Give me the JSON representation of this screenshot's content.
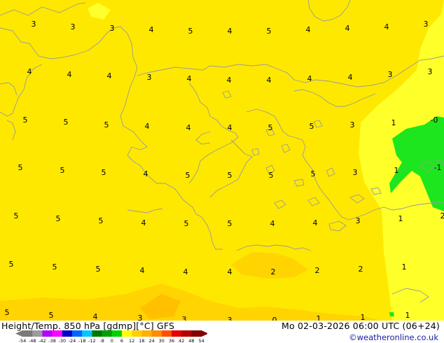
{
  "map": {
    "field_colors": {
      "land_base": "#ffe800",
      "light_yellow": "#ffff2a",
      "dark_yellow": "#ffd400",
      "orange_blob": "#ffc000",
      "green": "#1ee61e",
      "coastline": "#9a9a9a",
      "land_top": "#ffea00",
      "green_edge": "#14d214"
    },
    "grid_values": [
      "3",
      "3",
      "3",
      "4",
      "5",
      "4",
      "5",
      "4",
      "4",
      "4",
      "3",
      "4",
      "4",
      "4",
      "3",
      "4",
      "4",
      "4",
      "4",
      "4",
      "3",
      "3",
      "5",
      "5",
      "5",
      "4",
      "4",
      "4",
      "5",
      "5",
      "3",
      "1",
      "-0",
      "5",
      "5",
      "5",
      "4",
      "5",
      "5",
      "5",
      "5",
      "3",
      "1",
      "-1",
      "5",
      "5",
      "5",
      "4",
      "5",
      "5",
      "4",
      "4",
      "3",
      "1",
      "2",
      "5",
      "5",
      "5",
      "4",
      "4",
      "4",
      "2",
      "2",
      "2",
      "1",
      "5",
      "5",
      "4",
      "3",
      "3",
      "3",
      "0",
      "1",
      "1",
      "1"
    ]
  },
  "footer": {
    "title": "Height/Temp. 850 hPa [gdmp][°C] GFS",
    "valid": "Mo 02-03-2026 06:00 UTC (06+24)",
    "credit": "©weatheronline.co.uk"
  },
  "scale": {
    "ticks": [
      "-54",
      "-48",
      "-42",
      "-38",
      "-30",
      "-24",
      "-18",
      "-12",
      "-8",
      "0",
      "6",
      "12",
      "18",
      "24",
      "30",
      "36",
      "42",
      "48",
      "54"
    ],
    "colors": [
      "#7a7a7a",
      "#9c9c9c",
      "#b400ff",
      "#ff00ff",
      "#0000c8",
      "#0066ff",
      "#00c8ff",
      "#007800",
      "#00a000",
      "#00d200",
      "#ffff00",
      "#ffd000",
      "#ffb000",
      "#ff8c00",
      "#ff5000",
      "#e60000",
      "#b40000",
      "#820000"
    ]
  }
}
